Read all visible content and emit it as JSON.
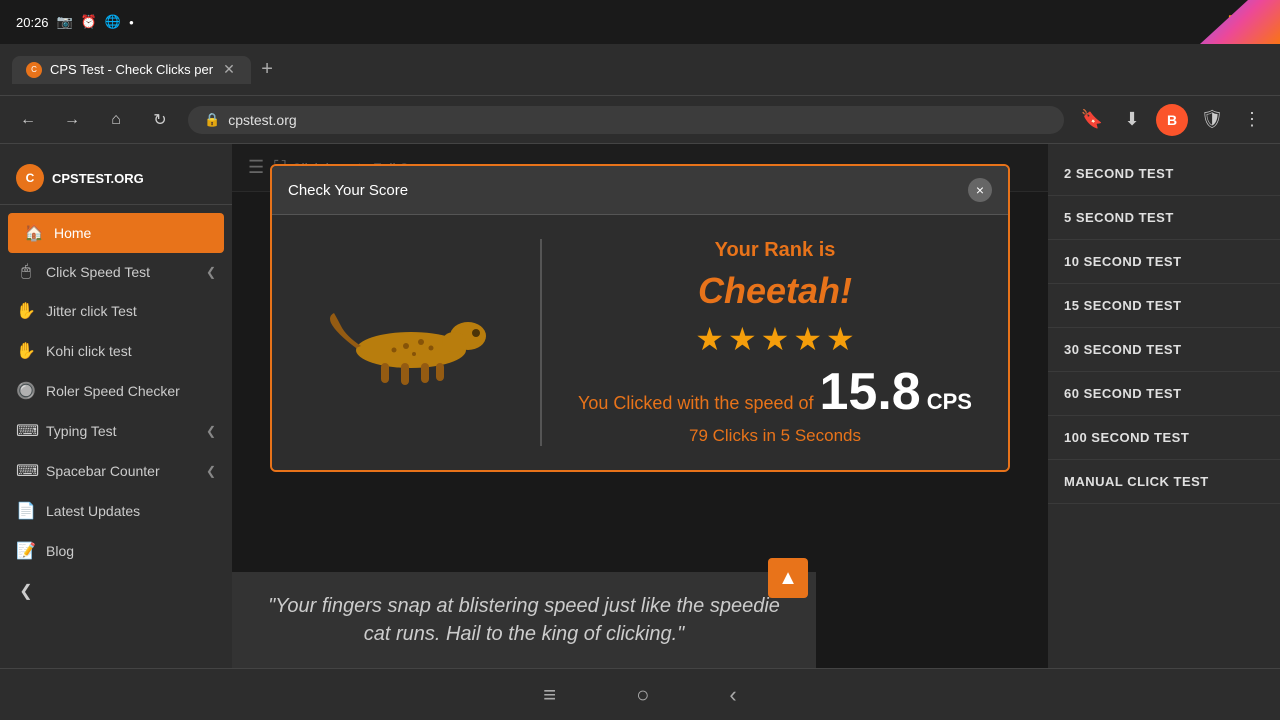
{
  "statusBar": {
    "time": "20:26",
    "icons": [
      "camera",
      "alarm",
      "wifi",
      "dots"
    ]
  },
  "browser": {
    "tab": {
      "title": "CPS Test - Check Clicks per",
      "favicon": "C"
    },
    "address": "cpstest.org",
    "newTabLabel": "+"
  },
  "sidebar": {
    "logo": "CPSTEST.ORG",
    "items": [
      {
        "id": "home",
        "label": "Home",
        "icon": "🏠",
        "active": true
      },
      {
        "id": "click-speed",
        "label": "Click Speed Test",
        "icon": "🖱",
        "hasArrow": true
      },
      {
        "id": "jitter",
        "label": "Jitter click Test",
        "icon": "✋"
      },
      {
        "id": "kohi",
        "label": "Kohi click test",
        "icon": "✋"
      },
      {
        "id": "roler",
        "label": "Roler Speed Checker",
        "icon": "🔘"
      },
      {
        "id": "typing",
        "label": "Typing Test",
        "icon": "⌨",
        "hasArrow": true
      },
      {
        "id": "spacebar",
        "label": "Spacebar Counter",
        "icon": "⌨",
        "hasArrow": true
      },
      {
        "id": "updates",
        "label": "Latest Updates",
        "icon": "📄"
      },
      {
        "id": "blog",
        "label": "Blog",
        "icon": "📝"
      }
    ],
    "collapseArrow": "❮"
  },
  "topBar": {
    "fullscreenLabel": "Click here to Full Screen"
  },
  "rightSidebar": {
    "items": [
      "2 SECOND TEST",
      "5 SECOND TEST",
      "10 SECOND TEST",
      "15 SECOND TEST",
      "30 SECOND TEST",
      "60 SECOND TEST",
      "100 SECOND TEST",
      "MANUAL CLICK TEST"
    ]
  },
  "modal": {
    "title": "Check Your Score",
    "rank_label": "Your Rank is",
    "rank_name": "Cheetah!",
    "stars": 5,
    "speed_prefix": "You Clicked with the speed of",
    "speed_value": "15.8",
    "speed_unit": "CPS",
    "clicks_info": "79 Clicks in 5 Seconds",
    "close_label": "×"
  },
  "quote": {
    "text": "\"Your fingers snap at blistering speed just like the speedie cat runs. Hail to the king of clicking.\""
  },
  "bottomNav": {
    "items": [
      "≡",
      "○",
      "‹"
    ]
  },
  "scrollTop": {
    "icon": "▲"
  }
}
